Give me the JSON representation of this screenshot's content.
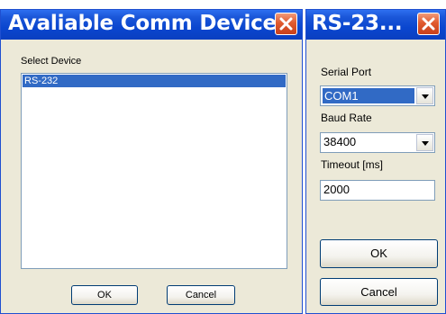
{
  "device_dialog": {
    "title": "Avaliable Comm Devices",
    "select_label": "Select Device",
    "devices": [
      "RS-232"
    ],
    "ok_label": "OK",
    "cancel_label": "Cancel"
  },
  "rs232_dialog": {
    "title": "RS-23...",
    "serial_port_label": "Serial Port",
    "serial_port_value": "COM1",
    "baud_rate_label": "Baud Rate",
    "baud_rate_value": "38400",
    "timeout_label": "Timeout  [ms]",
    "timeout_value": "2000",
    "ok_label": "OK",
    "cancel_label": "Cancel"
  },
  "colors": {
    "titlebar": "#0a46cf",
    "selection": "#316ac5",
    "dialog_bg": "#ece9d8",
    "close_button": "#e05a2f"
  },
  "icons": {
    "close": "close-icon",
    "dropdown": "chevron-down-icon"
  }
}
